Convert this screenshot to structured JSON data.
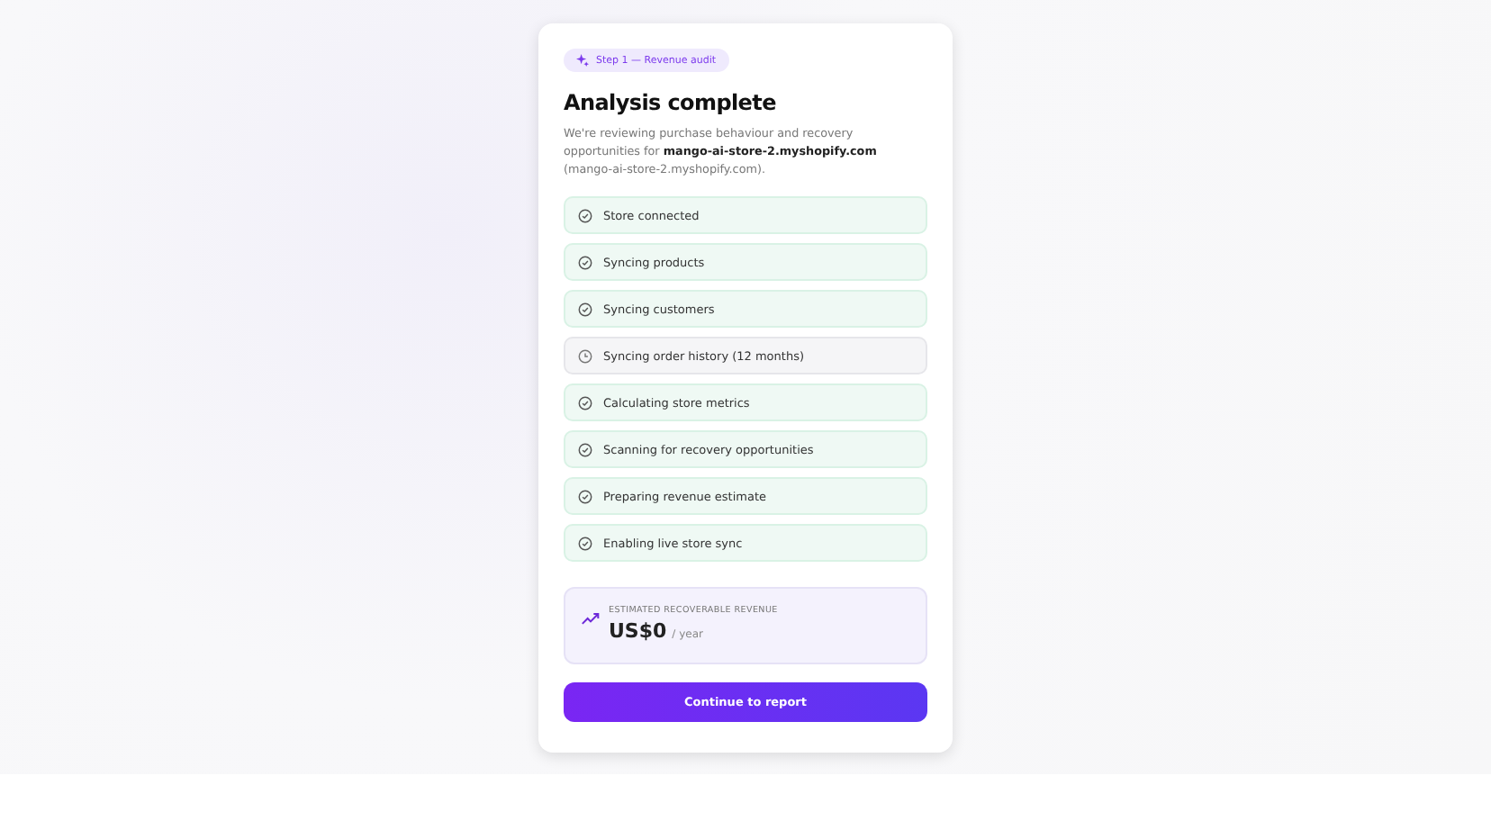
{
  "badge": "Step 1 — Revenue audit",
  "title": "Analysis complete",
  "description": "We're reviewing purchase behaviour and recovery opportunities for **mango-ai-store-2.myshopify.com** (mango-ai-store-2.myshopify.com).",
  "steps": [
    {
      "label": "Store connected",
      "done": true
    },
    {
      "label": "Syncing products",
      "done": true
    },
    {
      "label": "Syncing customers",
      "done": true
    },
    {
      "label": "Syncing order history (12 months)",
      "done": false
    },
    {
      "label": "Calculating store metrics",
      "done": true
    },
    {
      "label": "Scanning for recovery opportunities",
      "done": true
    },
    {
      "label": "Preparing revenue estimate",
      "done": true
    },
    {
      "label": "Enabling live store sync",
      "done": true
    }
  ],
  "estimate": {
    "label": "ESTIMATED RECOVERABLE REVENUE",
    "value": "US$0",
    "unit": "/ year"
  },
  "button": "Continue to report"
}
